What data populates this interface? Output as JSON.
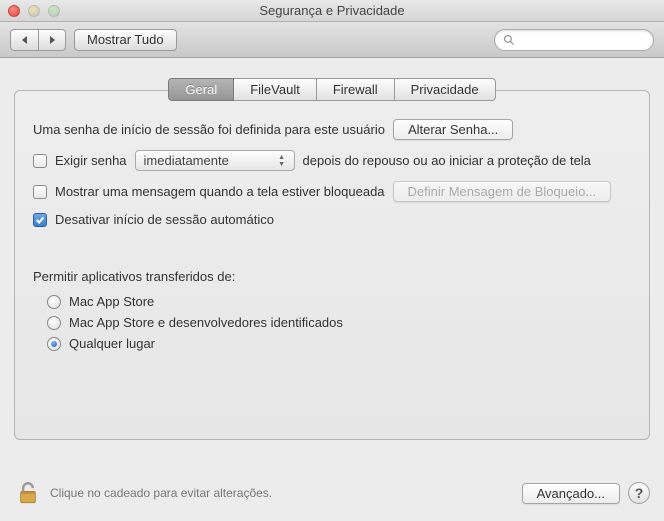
{
  "window": {
    "title": "Segurança e Privacidade"
  },
  "toolbar": {
    "show_all": "Mostrar Tudo",
    "search_placeholder": ""
  },
  "tabs": [
    {
      "label": "Geral",
      "active": true
    },
    {
      "label": "FileVault",
      "active": false
    },
    {
      "label": "Firewall",
      "active": false
    },
    {
      "label": "Privacidade",
      "active": false
    }
  ],
  "general": {
    "pw_set_text": "Uma senha de início de sessão foi definida para este usuário",
    "change_pw_btn": "Alterar Senha...",
    "require_pw": {
      "checked": false,
      "label_before": "Exigir senha",
      "select_value": "imediatamente",
      "label_after": "depois do repouso ou ao iniciar a proteção de tela"
    },
    "show_msg": {
      "checked": false,
      "label": "Mostrar uma mensagem quando a tela estiver bloqueada",
      "btn": "Definir Mensagem de Bloqueio..."
    },
    "disable_auto_login": {
      "checked": true,
      "label": "Desativar início de sessão automático"
    },
    "allow_apps_heading": "Permitir aplicativos transferidos de:",
    "allow_apps_options": [
      {
        "label": "Mac App Store",
        "selected": false
      },
      {
        "label": "Mac App Store e desenvolvedores identificados",
        "selected": false
      },
      {
        "label": "Qualquer lugar",
        "selected": true
      }
    ]
  },
  "footer": {
    "lock_text": "Clique no cadeado para evitar alterações.",
    "advanced_btn": "Avançado...",
    "help": "?"
  }
}
